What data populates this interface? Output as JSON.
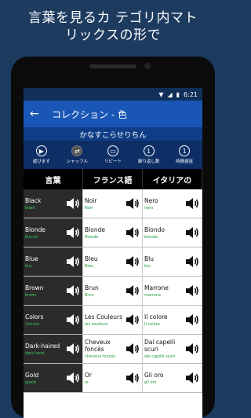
{
  "promo": {
    "line1": "言葉を見るカ テゴリ内マト",
    "line2": "リックスの形で"
  },
  "status": {
    "time": "6:21"
  },
  "appbar": {
    "back_icon": "arrow-left-icon",
    "title": "コレクション - 色"
  },
  "subtitle": "かなすこらせりちん",
  "toolbar": [
    {
      "icon": "play-icon",
      "glyph": "▶",
      "label": "遊びます"
    },
    {
      "icon": "shuffle-icon",
      "glyph": "⇄",
      "label": "シャッフル"
    },
    {
      "icon": "repeat-icon",
      "glyph": "▭",
      "label": "リピート"
    },
    {
      "icon": "repeat-count-icon",
      "glyph": "1",
      "label": "繰り返し数"
    },
    {
      "icon": "time-delay-icon",
      "glyph": "1",
      "label": "時間遅延"
    }
  ],
  "headers": [
    "言葉",
    "フランス語",
    "イタリアの"
  ],
  "rows": [
    {
      "en": "Black",
      "en_p": "blæk",
      "fr": "Noir",
      "fr_p": "Noir",
      "it": "Nero",
      "it_p": "nero"
    },
    {
      "en": "Blonde",
      "en_p": "blɑːnd",
      "fr": "Blonde",
      "fr_p": "Blonde",
      "it": "Biondo",
      "it_p": "biondo"
    },
    {
      "en": "Blue",
      "en_p": "bluː",
      "fr": "Bleu",
      "fr_p": "Bleu",
      "it": "Blu",
      "it_p": "blu"
    },
    {
      "en": "Brown",
      "en_p": "braʊn",
      "fr": "Brun",
      "fr_p": "Brun",
      "it": "Marrone",
      "it_p": "marrone"
    },
    {
      "en": "Colors",
      "en_p": "ˈkʌl.ərz",
      "fr": "Les Couleurs",
      "fr_p": "les couleurs",
      "it": "Il colore",
      "it_p": "Il colore"
    },
    {
      "en": "Dark-haired",
      "en_p": "dark-herd",
      "fr": "Cheveux foncés",
      "fr_p": "cheveux foncés",
      "it": "Dai capelli scuri",
      "it_p": "dai capelli scuri"
    },
    {
      "en": "Gold",
      "en_p": "ɡoʊld",
      "fr": "Or",
      "fr_p": "or",
      "it": "Gli oro",
      "it_p": "gli oro"
    }
  ]
}
